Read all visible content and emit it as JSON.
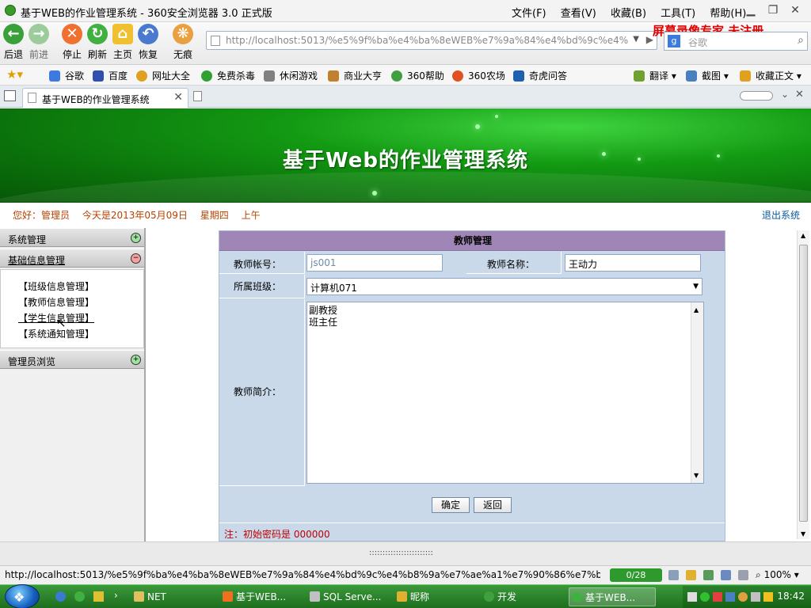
{
  "window": {
    "title": "基于WEB的作业管理系统 - 360安全浏览器 3.0 正式版",
    "menus": [
      "文件(F)",
      "查看(V)",
      "收藏(B)",
      "工具(T)",
      "帮助(H)"
    ]
  },
  "nav": {
    "back": "后退",
    "forward": "前进",
    "stop": "停止",
    "refresh": "刷新",
    "home": "主页",
    "restore": "恢复",
    "incognito": "无痕",
    "address": "http://localhost:5013/%e5%9f%ba%e4%ba%8eWEB%e7%9a%84%e4%bd%9c%e4%",
    "search_placeholder": "谷歌",
    "watermark": "屏幕录像专家  未注册"
  },
  "favorites": {
    "items": [
      "谷歌",
      "百度",
      "网址大全",
      "免费杀毒",
      "休闲游戏",
      "商业大亨",
      "360帮助",
      "360农场",
      "奇虎问答"
    ],
    "right": [
      "翻译",
      "截图",
      "收藏正文"
    ],
    "colors": [
      "#3d7ae0",
      "#3050b0",
      "#e0a020",
      "#30a030",
      "#808080",
      "#c08030",
      "#40a040",
      "#e05020",
      "#2060b0"
    ]
  },
  "tabs": {
    "active_label": "基于WEB的作业管理系统"
  },
  "banner": {
    "title": "基于Web的作业管理系统"
  },
  "info": {
    "greeting": "您好：管理员",
    "date": "今天是2013年05月09日",
    "weekday": "星期四",
    "period": "上午",
    "logout": "退出系统"
  },
  "sidebar": {
    "sections": [
      {
        "label": "系统管理"
      },
      {
        "label": "基础信息管理"
      },
      {
        "label": "管理员浏览"
      }
    ],
    "links": [
      "【班级信息管理】",
      "【教师信息管理】",
      "【学生信息管理】",
      "【系统通知管理】"
    ]
  },
  "form": {
    "title": "教师管理",
    "account_label": "教师帐号：",
    "account_value": "js001",
    "name_label": "教师名称：",
    "name_value": "王动力",
    "class_label": "所属班级：",
    "class_value": "计算机071",
    "intro_label": "教师简介：",
    "intro_lines": [
      "副教授",
      "班主任"
    ],
    "confirm": "确定",
    "back": "返回",
    "note": "注：初始密码是  000000"
  },
  "status": {
    "url": "http://localhost:5013/%e5%9f%ba%e4%ba%8eWEB%e7%9a%84%e4%bd%9c%e4%b8%9a%e7%ae%a1%e7%90%86%e7%b3...",
    "counter": "0/28",
    "zoom": "100%"
  },
  "taskbar": {
    "items": [
      "NET",
      "基于WEB...",
      "SQL Serve...",
      "昵称",
      "开发",
      "基于WEB..."
    ],
    "clock": "18:42"
  }
}
